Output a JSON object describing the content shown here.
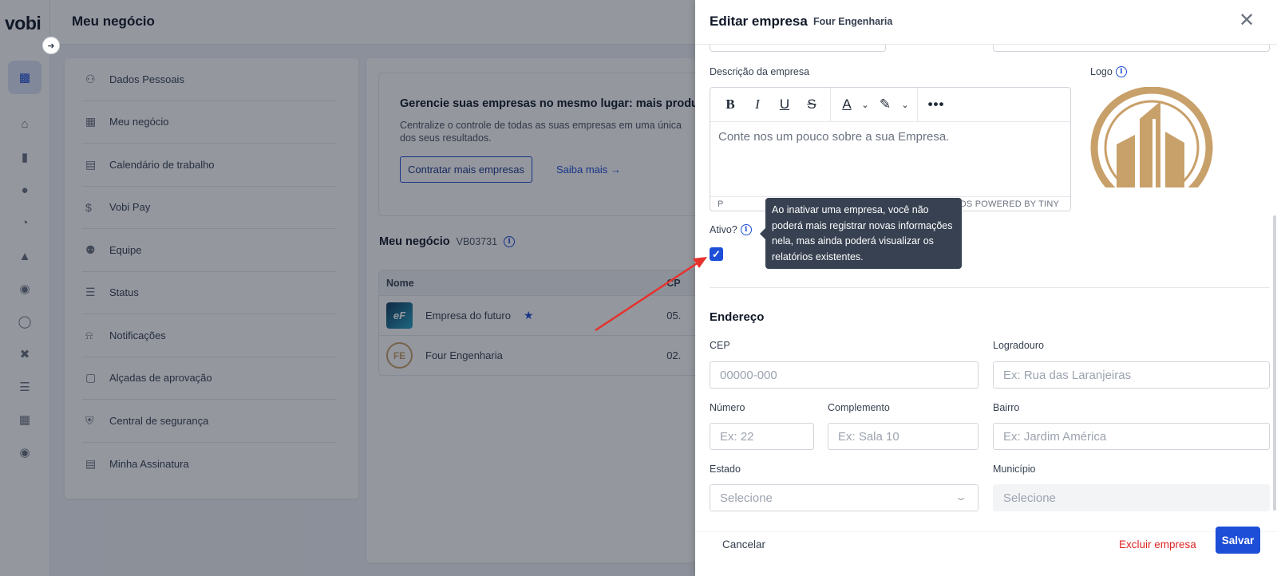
{
  "app": {
    "brand": "vobi",
    "page_title": "Meu negócio",
    "rail_icons": [
      "building-icon",
      "home-icon",
      "folder-icon",
      "handshake-icon",
      "gauge-icon",
      "worker-icon",
      "coins-icon",
      "dollar-icon",
      "tools-icon",
      "list-icon",
      "add-grid-icon",
      "team-icon"
    ],
    "menu": [
      {
        "label": "Dados Pessoais",
        "icon": "user-icon",
        "glyph": "⚇"
      },
      {
        "label": "Meu negócio",
        "icon": "building-icon",
        "glyph": "▦"
      },
      {
        "label": "Calendário de trabalho",
        "icon": "calendar-icon",
        "glyph": "▤"
      },
      {
        "label": "Vobi Pay",
        "icon": "dollar-circle-icon",
        "glyph": "$"
      },
      {
        "label": "Equipe",
        "icon": "team-icon",
        "glyph": "⚉"
      },
      {
        "label": "Status",
        "icon": "status-icon",
        "glyph": "☰"
      },
      {
        "label": "Notificações",
        "icon": "bell-icon",
        "glyph": "⍾"
      },
      {
        "label": "Alçadas de aprovação",
        "icon": "document-check-icon",
        "glyph": "▢"
      },
      {
        "label": "Central de segurança",
        "icon": "shield-icon",
        "glyph": "⛨"
      },
      {
        "label": "Minha Assinatura",
        "icon": "receipt-icon",
        "glyph": "▤"
      }
    ],
    "promo": {
      "title": "Gerencie suas empresas no mesmo lugar: mais produ",
      "desc_line1": "Centralize o controle de todas as suas empresas em uma única",
      "desc_line2": "dos seus resultados.",
      "cta": "Contratar mais empresas",
      "link": "Saiba mais"
    },
    "business": {
      "title": "Meu negócio",
      "code": "VB03731",
      "columns": [
        "Nome",
        "CP"
      ],
      "rows": [
        {
          "name": "Empresa do futuro",
          "cp": "05.",
          "logo": "eF",
          "favorite": true
        },
        {
          "name": "Four Engenharia",
          "cp": "02.",
          "logo": "FE",
          "favorite": false
        }
      ]
    }
  },
  "drawer": {
    "title": "Editar empresa",
    "subtitle": "Four Engenharia",
    "description_label": "Descrição da empresa",
    "description_placeholder": "Conte nos um pouco sobre a sua Empresa.",
    "editor_status_tag": "P",
    "editor_status_right": "0 WORDS  POWERED BY TINY",
    "logo_label": "Logo",
    "active_label": "Ativo?",
    "active_checked": true,
    "tooltip": "Ao inativar uma empresa, você não poderá mais registrar novas informações nela, mas ainda poderá visualizar os relatórios existentes.",
    "address_title": "Endereço",
    "fields": {
      "cep": {
        "label": "CEP",
        "placeholder": "00000-000"
      },
      "logradouro": {
        "label": "Logradouro",
        "placeholder": "Ex: Rua das Laranjeiras"
      },
      "numero": {
        "label": "Número",
        "placeholder": "Ex: 22"
      },
      "complemento": {
        "label": "Complemento",
        "placeholder": "Ex: Sala 10"
      },
      "bairro": {
        "label": "Bairro",
        "placeholder": "Ex: Jardim América"
      },
      "estado": {
        "label": "Estado",
        "value": "Selecione"
      },
      "municipio": {
        "label": "Município",
        "value": "Selecione"
      }
    },
    "footer": {
      "cancel": "Cancelar",
      "delete": "Excluir empresa",
      "save": "Salvar"
    },
    "colors": {
      "primary": "#1d4ed8",
      "danger": "#dc2626",
      "logo_gold": "#c8a06a",
      "annotation_arrow": "#e5322d"
    }
  }
}
